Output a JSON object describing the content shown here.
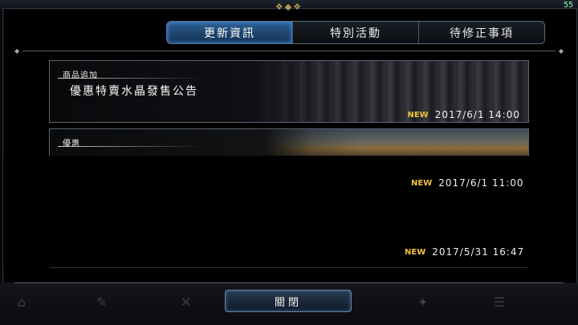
{
  "status": {
    "corner_text": "55"
  },
  "tabs": [
    {
      "label": "更新資訊",
      "active": true
    },
    {
      "label": "特別活動",
      "active": false
    },
    {
      "label": "待修正事項",
      "active": false
    }
  ],
  "notices": [
    {
      "tag": "商品追加",
      "title": "優惠特賣水晶發售公告",
      "badge": "NEW",
      "date": "2017/6/1 14:00"
    },
    {
      "tag": "優惠",
      "title": "",
      "badge": "NEW",
      "date": "2017/6/1 11:00"
    },
    {
      "tag": "",
      "title": "",
      "badge": "NEW",
      "date": "2017/5/31 16:47"
    }
  ],
  "close_button": {
    "label": "關閉"
  },
  "colors": {
    "active_tab": "#2c5f94",
    "new_badge": "#f0c040",
    "ornament": "#b9965a"
  }
}
